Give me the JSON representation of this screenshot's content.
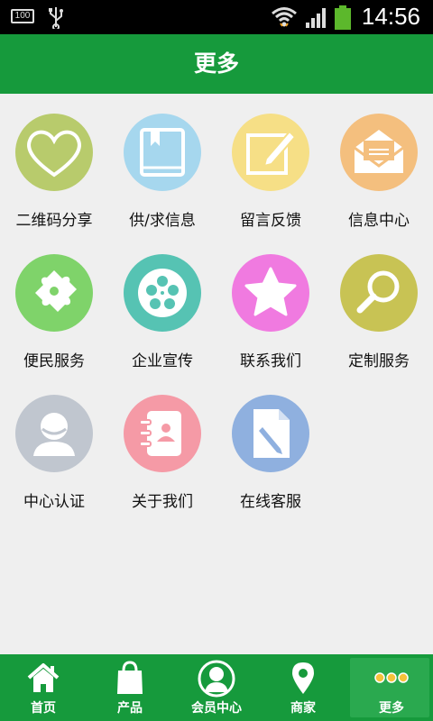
{
  "status_bar": {
    "battery_indicator": "100",
    "time": "14:56",
    "icons": [
      "usb-icon",
      "wifi-icon",
      "signal-icon",
      "battery-icon"
    ]
  },
  "header": {
    "title": "更多"
  },
  "grid": {
    "items": [
      {
        "label": "二维码分享",
        "icon": "heart-icon",
        "color": "#b8cb6c"
      },
      {
        "label": "供/求信息",
        "icon": "book-icon",
        "color": "#a6d7ee"
      },
      {
        "label": "留言反馈",
        "icon": "note-pencil-icon",
        "color": "#f6df86"
      },
      {
        "label": "信息中心",
        "icon": "envelope-icon",
        "color": "#f4bf7e"
      },
      {
        "label": "便民服务",
        "icon": "puzzle-icon",
        "color": "#7fd36a"
      },
      {
        "label": "企业宣传",
        "icon": "film-reel-icon",
        "color": "#56c3b3"
      },
      {
        "label": "联系我们",
        "icon": "star-icon",
        "color": "#f07ae0"
      },
      {
        "label": "定制服务",
        "icon": "magnifier-icon",
        "color": "#c8c354"
      },
      {
        "label": "中心认证",
        "icon": "user-icon",
        "color": "#c0c6cf"
      },
      {
        "label": "关于我们",
        "icon": "contacts-book-icon",
        "color": "#f59aa6"
      },
      {
        "label": "在线客服",
        "icon": "document-edit-icon",
        "color": "#8fb0df"
      }
    ]
  },
  "bottom_nav": {
    "items": [
      {
        "label": "首页",
        "icon": "home-icon"
      },
      {
        "label": "产品",
        "icon": "shopping-bag-icon"
      },
      {
        "label": "会员中心",
        "icon": "member-avatar-icon"
      },
      {
        "label": "商家",
        "icon": "location-pin-icon"
      },
      {
        "label": "更多",
        "icon": "more-dots-icon",
        "active": true
      }
    ]
  },
  "colors": {
    "brand_green": "#169a3c",
    "background": "#efefef"
  }
}
